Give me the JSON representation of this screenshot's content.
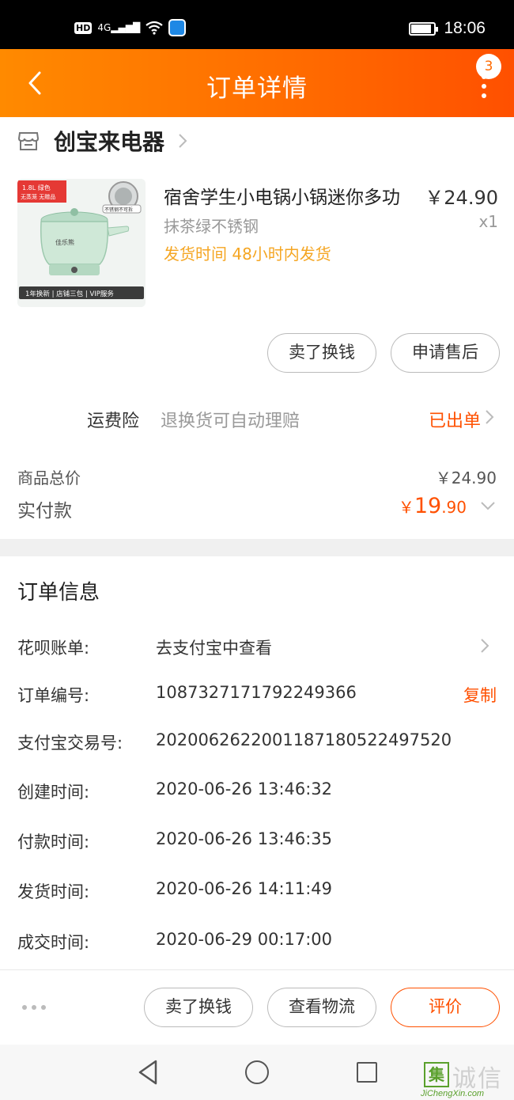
{
  "status_bar": {
    "network": "4G",
    "hd": "HD",
    "time": "18:06",
    "battery_level": 0.9
  },
  "header": {
    "title": "订单详情",
    "badge_count": "3"
  },
  "shop": {
    "name": "创宝来电器"
  },
  "product": {
    "title": "宿舍学生小电锅小锅迷你多功",
    "price": "￥24.90",
    "spec": "抹茶绿不锈钢",
    "qty": "x1",
    "ship_label": "发货时间",
    "ship_value": "48小时内发货",
    "img_tag_top": "1.8L 绿色",
    "img_tag_sub": "无蒸笼 无赠品",
    "img_badge": "不锈钢不可拆",
    "img_brand": "佳乐熊",
    "img_footer": "1年换新 | 店铺三包 | VIP服务"
  },
  "product_actions": {
    "sell": "卖了换钱",
    "after_sale": "申请售后"
  },
  "insurance": {
    "label": "运费险",
    "desc": "退换货可自动理赔",
    "status": "已出单"
  },
  "totals": {
    "goods_label": "商品总价",
    "goods_value": "￥24.90",
    "paid_label": "实付款",
    "paid_currency": "￥",
    "paid_int": "19",
    "paid_dec": ".90"
  },
  "order_info": {
    "title": "订单信息",
    "rows": [
      {
        "key": "花呗账单:",
        "value": "去支付宝中查看"
      },
      {
        "key": "订单编号:",
        "value": "1087327171792249366",
        "action": "复制"
      },
      {
        "key": "支付宝交易号:",
        "value": "2020062622001187180522497520"
      },
      {
        "key": "创建时间:",
        "value": "2020-06-26 13:46:32"
      },
      {
        "key": "付款时间:",
        "value": "2020-06-26 13:46:35"
      },
      {
        "key": "发货时间:",
        "value": "2020-06-26 14:11:49"
      },
      {
        "key": "成交时间:",
        "value": "2020-06-29 00:17:00"
      }
    ]
  },
  "bottom_actions": {
    "sell": "卖了换钱",
    "logistics": "查看物流",
    "review": "评价"
  },
  "watermark": {
    "box": "集",
    "text": "诚信",
    "url": "JiChengXin.com"
  },
  "colors": {
    "accent": "#ff5000",
    "header_start": "#ff8a00",
    "ship_text": "#f5a623"
  }
}
